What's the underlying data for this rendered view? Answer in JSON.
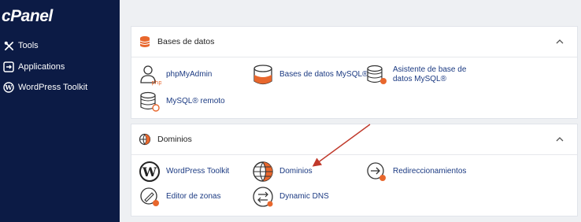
{
  "sidebar": {
    "logo": "cPanel",
    "items": [
      {
        "label": "Tools"
      },
      {
        "label": "Applications"
      },
      {
        "label": "WordPress Toolkit"
      }
    ]
  },
  "databases": {
    "title": "Bases de datos",
    "items": [
      {
        "label": "phpMyAdmin"
      },
      {
        "label": "Bases de datos MySQL®"
      },
      {
        "label": "Asistente de base de datos MySQL®"
      },
      {
        "label": "MySQL® remoto"
      }
    ]
  },
  "domains": {
    "title": "Dominios",
    "items": [
      {
        "label": "WordPress Toolkit"
      },
      {
        "label": "Dominios"
      },
      {
        "label": "Redireccionamientos"
      },
      {
        "label": "Editor de zonas"
      },
      {
        "label": "Dynamic DNS"
      }
    ]
  },
  "colors": {
    "sidebar": "#0c1b45",
    "link": "#1b3a82",
    "accent": "#e8672d",
    "arrow": "#c0392b"
  },
  "icons": [
    "tools-icon",
    "applications-icon",
    "wordpress-icon",
    "database-icon",
    "globe-icon",
    "chevron-up-icon"
  ]
}
